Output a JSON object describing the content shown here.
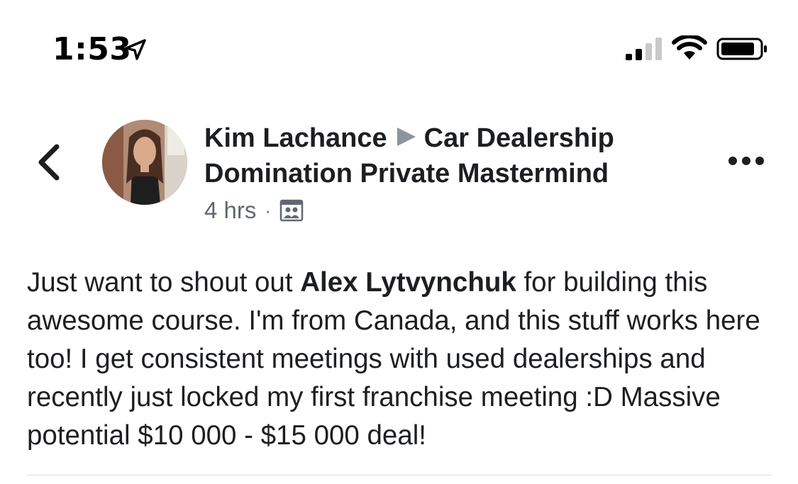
{
  "status_bar": {
    "time": "1:53",
    "icons": [
      "location-arrow-icon",
      "cellular-signal-icon",
      "wifi-icon",
      "battery-icon"
    ]
  },
  "post": {
    "author": "Kim Lachance",
    "group": "Car Dealership Domination Private Mastermind",
    "timestamp": "4 hrs",
    "separator": "·",
    "audience_icon": "group-audience-icon",
    "text_before_mention": "Just want to shout out ",
    "mention": "Alex Lytvynchuk",
    "text_after_mention": " for building this awesome course. I'm from Canada, and this stuff works here too! I get consistent meetings with used dealerships and recently just locked my first franchise meeting :D Massive potential $10 000 - $15 000 deal!"
  },
  "colors": {
    "primary_text": "#1c1e21",
    "secondary_text": "#606770",
    "arrow_gray": "#8d949e",
    "divider": "#dadde1"
  }
}
